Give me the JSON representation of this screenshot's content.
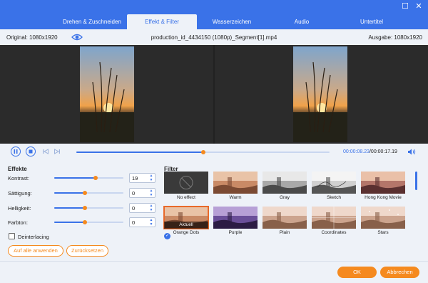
{
  "window": {
    "restore_glyph": "☐",
    "close_glyph": "✕"
  },
  "tabs": [
    {
      "label": "Drehen & Zuschneiden"
    },
    {
      "label": "Effekt & Filter"
    },
    {
      "label": "Wasserzeichen"
    },
    {
      "label": "Audio"
    },
    {
      "label": "Untertitel"
    }
  ],
  "active_tab": 1,
  "info": {
    "original": "Original: 1080x1920",
    "filename": "production_id_4434150 (1080p)_Segment[1].mp4",
    "output": "Ausgabe: 1080x1920",
    "eye_icon": "eye-icon"
  },
  "player": {
    "current_time": "00:00:08.23",
    "total_time": "/00:00:17.19",
    "progress": 0.5
  },
  "effects": {
    "title": "Effekte",
    "rows": [
      {
        "label": "Kontrast:",
        "value": "19",
        "level": 0.6
      },
      {
        "label": "Sättigung:",
        "value": "0",
        "level": 0.44
      },
      {
        "label": "Helligkeit:",
        "value": "0",
        "level": 0.44
      },
      {
        "label": "Farbton:",
        "value": "0",
        "level": 0.44
      }
    ],
    "deinterlacing": "Deinterlacing",
    "apply_all": "Auf alle anwenden",
    "reset": "Zurücksetzen"
  },
  "filter": {
    "title": "Filter",
    "current_badge": "Aktuell",
    "items": [
      {
        "label": "No effect",
        "style": "none"
      },
      {
        "label": "Warm",
        "style": "warm"
      },
      {
        "label": "Gray",
        "style": "gray"
      },
      {
        "label": "Sketch",
        "style": "sketch"
      },
      {
        "label": "Hong Kong Movie",
        "style": "hk"
      },
      {
        "label": "Orange Dots",
        "style": "orange",
        "selected": true
      },
      {
        "label": "Purple",
        "style": "purple"
      },
      {
        "label": "Plain",
        "style": "plain"
      },
      {
        "label": "Coordinates",
        "style": "coord"
      },
      {
        "label": "Stars",
        "style": "stars"
      }
    ]
  },
  "footer": {
    "ok": "OK",
    "cancel": "Abbrechen"
  },
  "colors": {
    "accent": "#3a72e8",
    "orange": "#f58a1f"
  }
}
